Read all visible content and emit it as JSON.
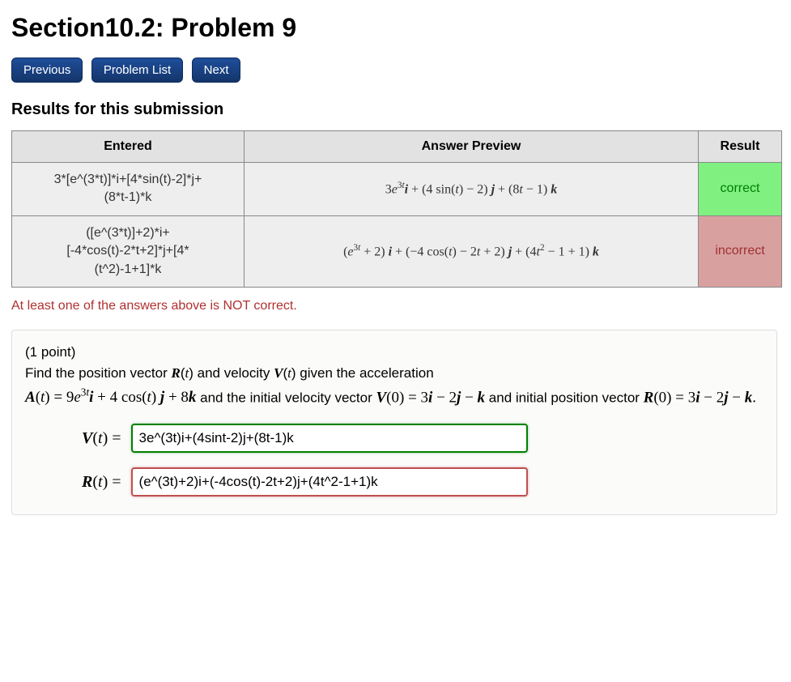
{
  "title": "Section10.2: Problem 9",
  "nav": {
    "prev": "Previous",
    "list": "Problem List",
    "next": "Next"
  },
  "results_heading": "Results for this submission",
  "table": {
    "headers": {
      "entered": "Entered",
      "preview": "Answer Preview",
      "result": "Result"
    },
    "rows": [
      {
        "entered_lines": [
          "3*[e^(3*t)]*i+[4*sin(t)-2]*j+",
          "(8*t-1)*k"
        ],
        "preview_html": "3<span class='mvar'>e</span><sup>3<span class='mvar'>t</span></sup><span class='mbold'>i</span> + (4 sin(<span class='mvar'>t</span>) − 2) <span class='mbold'>j</span> + (8<span class='mvar'>t</span> − 1) <span class='mbold'>k</span>",
        "result": "correct",
        "result_class": "correct"
      },
      {
        "entered_lines": [
          "([e^(3*t)]+2)*i+",
          "[-4*cos(t)-2*t+2]*j+[4*",
          "(t^2)-1+1]*k"
        ],
        "preview_html": "(<span class='mvar'>e</span><sup>3<span class='mvar'>t</span></sup> + 2) <span class='mbold'>i</span> + (−4 cos(<span class='mvar'>t</span>) − 2<span class='mvar'>t</span> + 2) <span class='mbold'>j</span> + (4<span class='mvar'>t</span><sup>2</sup> − 1 + 1) <span class='mbold'>k</span>",
        "result": "incorrect",
        "result_class": "incorrect"
      }
    ]
  },
  "warning": "At least one of the answers above is NOT correct.",
  "problem": {
    "points": "(1 point)",
    "intro_html": "Find the position vector <span class='mbold'>R</span>(<span class='mvar'>t</span>) and velocity <span class='mbold'>V</span>(<span class='mvar'>t</span>) given the acceleration",
    "accel_html": "<span class='mbold'>A</span>(<span class='mvar'>t</span>) = 9<span class='mvar'>e</span><sup>3<span class='mvar'>t</span></sup><span class='mbold'>i</span> + 4 cos(<span class='mvar'>t</span>) <span class='mbold'>j</span> + 8<span class='mbold'>k</span>",
    "mid_text": " and the initial velocity vector ",
    "v0_html": "<span class='mbold'>V</span>(0) = 3<span class='mbold'>i</span> − 2<span class='mbold'>j</span> − <span class='mbold'>k</span>",
    "mid_text2": " and initial position vector ",
    "r0_html": "<span class='mbold'>R</span>(0) = 3<span class='mbold'>i</span> − 2<span class='mbold'>j</span> − <span class='mbold'>k</span>."
  },
  "answers": {
    "v_label_html": "<span class='mbold'>V</span>(<span class='mvar'>t</span>) = ",
    "v_value": "3e^(3t)i+(4sint-2)j+(8t-1)k",
    "r_label_html": "<span class='mbold'>R</span>(<span class='mvar'>t</span>) = ",
    "r_value": "(e^(3t)+2)i+(-4cos(t)-2t+2)j+(4t^2-1+1)k"
  }
}
